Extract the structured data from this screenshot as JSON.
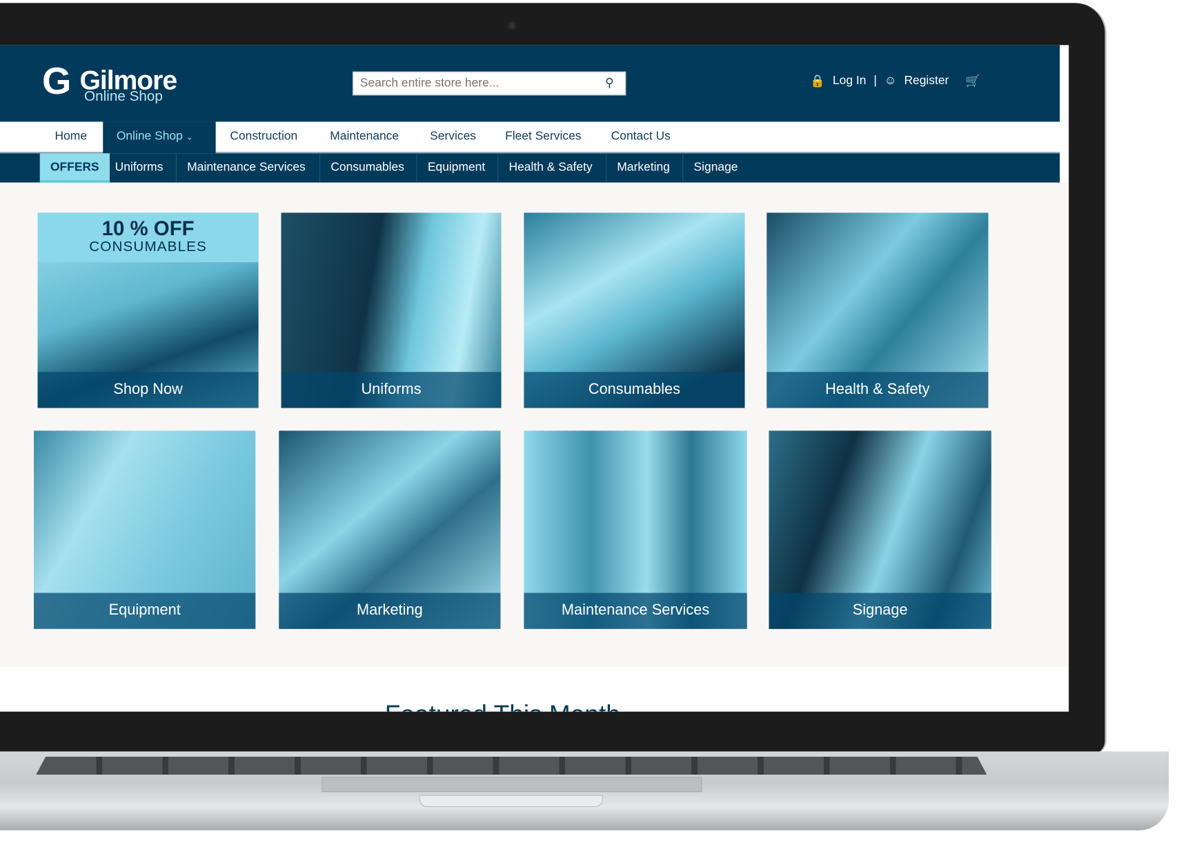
{
  "header": {
    "brand": "Gilmore",
    "brand_sub": "Online Shop",
    "search_placeholder": "Search entire store here...",
    "login": "Log In",
    "separator": "|",
    "register": "Register"
  },
  "nav": {
    "items": [
      "Home",
      "Online Shop",
      "Construction",
      "Maintenance",
      "Services",
      "Fleet Services",
      "Contact Us"
    ],
    "active": "Online Shop"
  },
  "subnav": {
    "items": [
      "OFFERS",
      "Uniforms",
      "Maintenance Services",
      "Consumables",
      "Equipment",
      "Health & Safety",
      "Marketing",
      "Signage"
    ]
  },
  "promo": {
    "line1": "10 % OFF",
    "line2": "CONSUMABLES"
  },
  "tiles": [
    "Shop Now",
    "Uniforms",
    "Consumables",
    "Health & Safety",
    "Equipment",
    "Marketing",
    "Maintenance Services",
    "Signage"
  ],
  "featured_heading": "Featured This Month",
  "colors": {
    "brand_navy": "#023a5b",
    "accent_cyan": "#8fdcec",
    "content_bg": "#f8f7f5"
  }
}
